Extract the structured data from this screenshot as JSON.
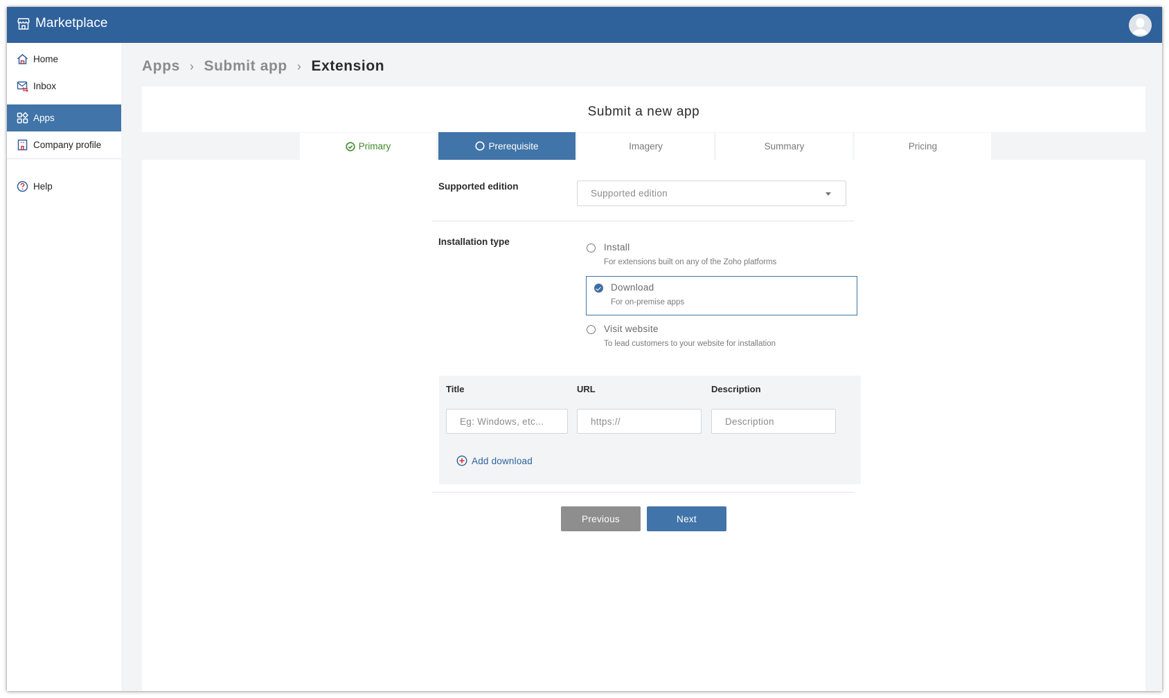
{
  "app": {
    "title": "Marketplace",
    "icon": "storefront-icon",
    "colors": {
      "header": "#2f619b",
      "accent": "#4174a8",
      "success": "#3d8c2a",
      "add_icon": "#d0343c"
    }
  },
  "user": {
    "avatar": "user-avatar-icon"
  },
  "sidebar": {
    "items": [
      {
        "label": "Home",
        "icon": "home-icon",
        "active": false
      },
      {
        "label": "Inbox",
        "icon": "inbox-icon",
        "active": false
      },
      {
        "label": "Apps",
        "icon": "apps-grid-icon",
        "active": true
      },
      {
        "label": "Company profile",
        "icon": "building-icon",
        "active": false
      },
      {
        "label": "Help",
        "icon": "help-circle-icon",
        "active": false
      }
    ]
  },
  "breadcrumb": {
    "items": [
      "Apps",
      "Submit app",
      "Extension"
    ],
    "separator": "›"
  },
  "page": {
    "title": "Submit a new app"
  },
  "tabs": [
    {
      "label": "Primary",
      "state": "completed",
      "icon": "check-circle-icon"
    },
    {
      "label": "Prerequisite",
      "state": "active",
      "icon": "circle-outline-icon"
    },
    {
      "label": "Imagery",
      "state": "pending"
    },
    {
      "label": "Summary",
      "state": "pending"
    },
    {
      "label": "Pricing",
      "state": "pending"
    }
  ],
  "form": {
    "supported_edition": {
      "label": "Supported edition",
      "placeholder": "Supported edition",
      "value": ""
    },
    "installation_type": {
      "label": "Installation type",
      "selected": "Download",
      "options": [
        {
          "title": "Install",
          "description": "For extensions built on any of the Zoho platforms",
          "checked": false
        },
        {
          "title": "Download",
          "description": "For on-premise apps",
          "checked": true
        },
        {
          "title": "Visit website",
          "description": "To lead customers to your website for installation",
          "checked": false
        }
      ]
    },
    "downloads": {
      "columns": [
        "Title",
        "URL",
        "Description"
      ],
      "rows": [
        {
          "title": {
            "value": "",
            "placeholder": "Eg: Windows, etc..."
          },
          "url": {
            "value": "",
            "placeholder": "https://"
          },
          "description": {
            "value": "",
            "placeholder": "Description"
          }
        }
      ],
      "add_label": "Add download"
    }
  },
  "actions": {
    "previous": "Previous",
    "next": "Next"
  }
}
